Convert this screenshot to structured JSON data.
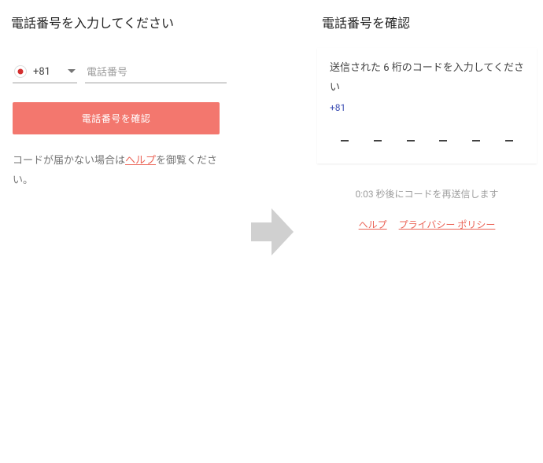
{
  "left": {
    "title": "電話番号を入力してください",
    "dial_code": "+81",
    "phone_placeholder": "電話番号",
    "verify_button": "電話番号を確認",
    "help_prefix": "コードが届かない場合は",
    "help_link": "ヘルプ",
    "help_suffix": "を御覧ください。"
  },
  "right": {
    "title": "電話番号を確認",
    "instruction": "送信された 6 桁のコードを入力してください",
    "dial_code": "+81",
    "resend_text": "0:03 秒後にコードを再送信します",
    "help_link": "ヘルプ",
    "privacy_link": "プライバシー ポリシー"
  }
}
